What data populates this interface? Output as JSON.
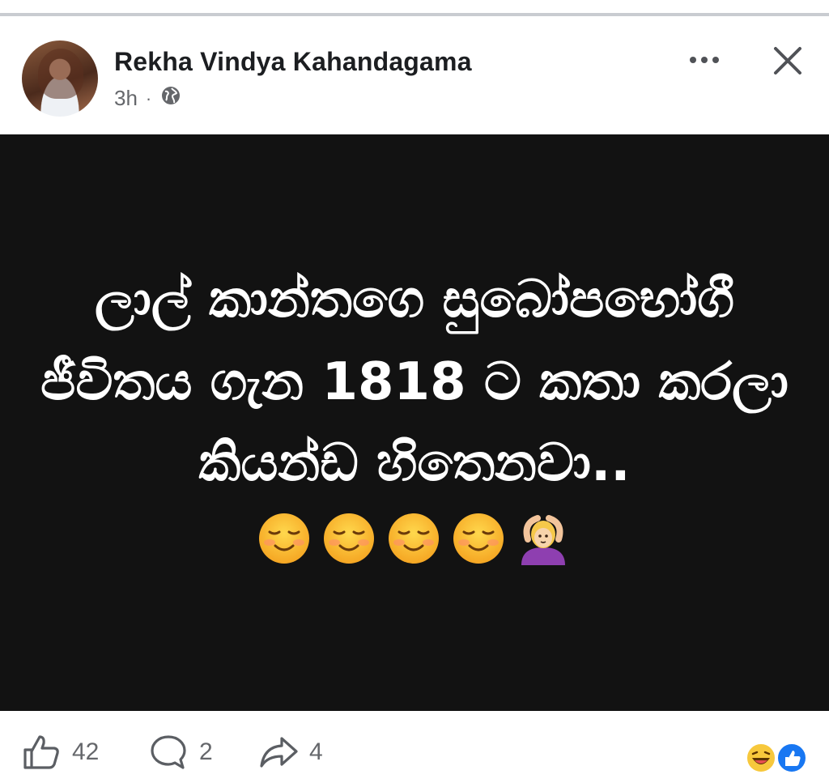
{
  "post": {
    "author": "Rekha Vindya Kahandagama",
    "time": "3h",
    "separator": "·",
    "privacy_icon": "globe-icon",
    "header_actions": [
      "more-icon",
      "close-icon"
    ],
    "content_lines": [
      "ලාල් කාන්තගෙ සුබෝපභෝගී",
      "ජීවිතය ගැන 1818 ට කතා කරලා",
      "කියන්ඩ හිතෙනවා.."
    ],
    "emojis": [
      "smiling-face-icon",
      "smiling-face-icon",
      "smiling-face-icon",
      "smiling-face-icon",
      "woman-gesturing-ok-icon"
    ],
    "background_color": "#121212",
    "text_color": "#ffffff"
  },
  "footer": {
    "likes": "42",
    "comments": "2",
    "shares": "4",
    "reaction_icons": [
      "laughing-face-icon",
      "like-badge-icon"
    ],
    "accent_color": "#1877f2"
  }
}
